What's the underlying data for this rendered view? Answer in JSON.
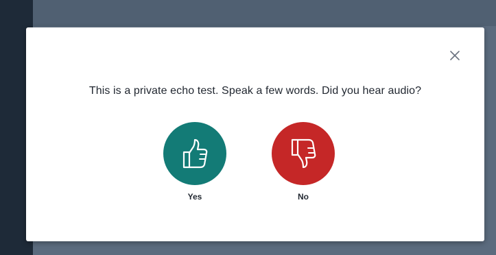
{
  "dialog": {
    "message": "This is a private echo test. Speak a few words. Did you hear audio?",
    "close_icon": "close-icon",
    "yes": {
      "label": "Yes",
      "icon": "thumbs-up-icon",
      "color": "#137b76"
    },
    "no": {
      "label": "No",
      "icon": "thumbs-down-icon",
      "color": "#c52727"
    }
  }
}
